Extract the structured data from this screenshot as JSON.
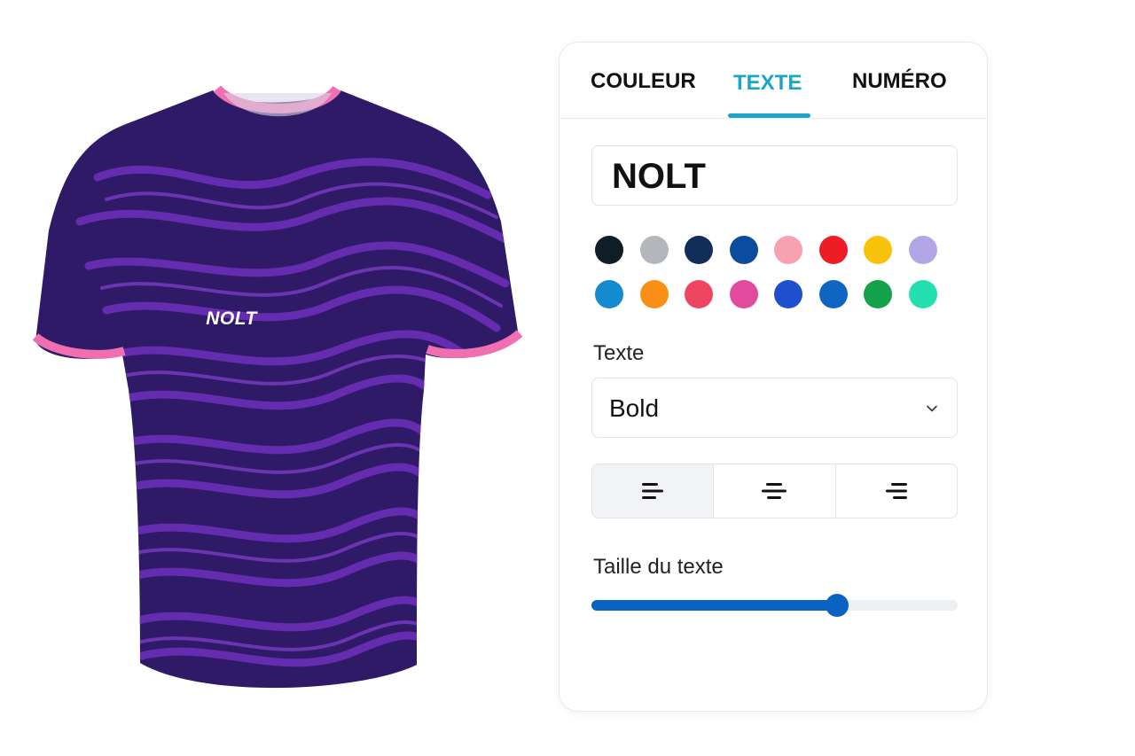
{
  "jersey": {
    "logo_text": "NOLT",
    "body_color": "#2e1a66",
    "pattern_color": "#6a2eb4",
    "trim_color": "#ef6fb0"
  },
  "tabs": [
    {
      "label": "COULEUR",
      "active": false
    },
    {
      "label": "TEXTE",
      "active": true
    },
    {
      "label": "NUMÉRO",
      "active": false
    }
  ],
  "text_input": {
    "value": "NOLT"
  },
  "swatches": {
    "row1": [
      "#0f1d27",
      "#b3b7bb",
      "#112f58",
      "#0b4c9e",
      "#f7a1b1",
      "#ee1c25",
      "#f9c20b",
      "#b2a6e6"
    ],
    "row2": [
      "#148bce",
      "#f99015",
      "#ee4660",
      "#e14a9d",
      "#1f4fcf",
      "#0f66c2",
      "#13a24a",
      "#24e0b0"
    ]
  },
  "font_label": "Texte",
  "font_select": {
    "value": "Bold",
    "icon": "chevron-down-icon"
  },
  "alignment": {
    "options": [
      "align-left-icon",
      "align-center-icon",
      "align-right-icon"
    ],
    "selected": "align-left-icon"
  },
  "size_label": "Taille du texte",
  "size_slider": {
    "value": 0.67
  },
  "accent_color": "#1aa6c4",
  "slider_color": "#0a63c2"
}
